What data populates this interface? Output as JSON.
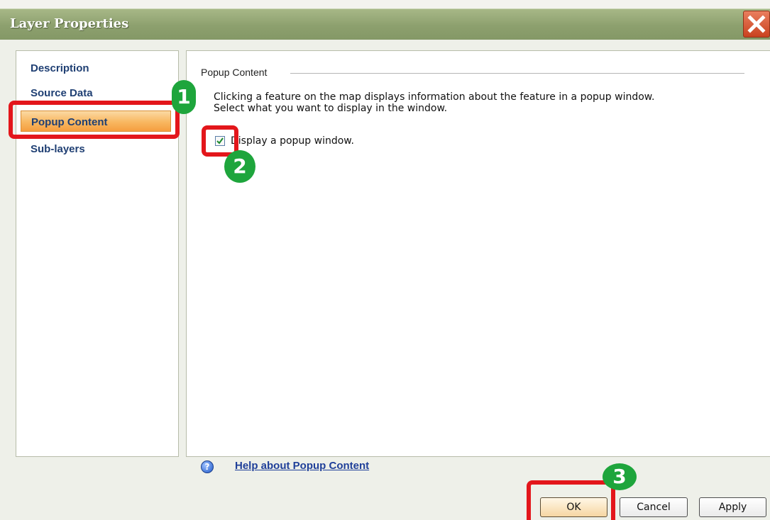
{
  "window": {
    "title": "Layer Properties"
  },
  "nav": {
    "items": [
      {
        "label": "Description"
      },
      {
        "label": "Source Data"
      },
      {
        "label": "Popup Content"
      },
      {
        "label": "Sub-layers"
      }
    ],
    "selected": "Popup Content"
  },
  "content": {
    "section_title": "Popup Content",
    "description_line1": "Clicking  a feature on the map displays information about the feature in a popup window.",
    "description_line2": "Select what you want to display in the window.",
    "checkbox_label": "Display a popup window.",
    "checkbox_checked": true,
    "help_link": "Help about Popup Content"
  },
  "buttons": {
    "ok": "OK",
    "cancel": "Cancel",
    "apply": "Apply"
  },
  "annotations": {
    "step1": "1",
    "step2": "2",
    "step3": "3"
  },
  "colors": {
    "highlight": "#e3161b",
    "badge": "#1ea53c",
    "selected": "#f8b760"
  }
}
